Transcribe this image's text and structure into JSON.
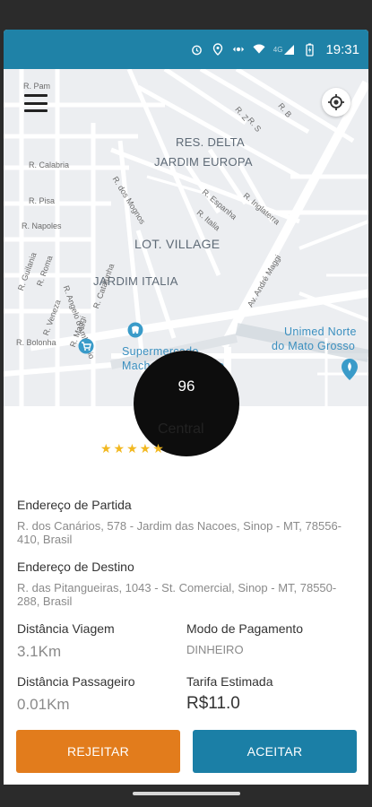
{
  "status_bar": {
    "time": "19:31",
    "network": "4G"
  },
  "map": {
    "labels": {
      "res_delta": "RES. DELTA",
      "jardim_europa": "JARDIM EUROPA",
      "lot_village": "LOT. VILLAGE",
      "jardim_italia": "JARDIM ITALIA",
      "supermercado": "Supermercado",
      "machado_aeroporto": "Machado Aeroporto",
      "unimed": "Unimed Norte",
      "mato_grosso": "do Mato Grosso"
    },
    "streets": {
      "s1": "R. Pam",
      "s2": "R. Calabria",
      "s3": "R. Pisa",
      "s4": "R. Napoles",
      "s5": "R. Guilania",
      "s6": "R. Roma",
      "s7": "R. Veneza",
      "s8": "R. Bolonha",
      "s9": "R. Angelo d'Ambrosio",
      "s10": "R. Catalunha",
      "s11": "R. Maggi",
      "s12": "R. dos Mognos",
      "s13": "R. Espanha",
      "s14": "R. Italia",
      "s15": "R. Inglaterra",
      "s16": "Av. André Maggi",
      "s17": "R. B",
      "s18": "R. S",
      "s19": "R. Z"
    }
  },
  "ride": {
    "badge_number": "96",
    "driver_name": "Central",
    "rating_stars": "★★★★★",
    "rating": 5,
    "pickup_label": "Endereço de Partida",
    "pickup_address": "R. dos Canários, 578 - Jardim das Nacoes, Sinop - MT, 78556-410, Brasil",
    "destination_label": "Endereço de Destino",
    "destination_address": "R. das Pitangueiras, 1043 - St. Comercial, Sinop - MT, 78550-288, Brasil",
    "trip_distance_label": "Distância Viagem",
    "trip_distance_value": "3.1Km",
    "payment_label": "Modo de Pagamento",
    "payment_value": "DINHEIRO",
    "passenger_distance_label": "Distância Passageiro",
    "passenger_distance_value": "0.01Km",
    "fare_label": "Tarifa Estimada",
    "fare_value": "R$11.0"
  },
  "actions": {
    "reject": "REJEITAR",
    "accept": "ACEITAR"
  },
  "colors": {
    "primary": "#1f82a7",
    "reject": "#e27c1c",
    "star": "#f2b820"
  }
}
